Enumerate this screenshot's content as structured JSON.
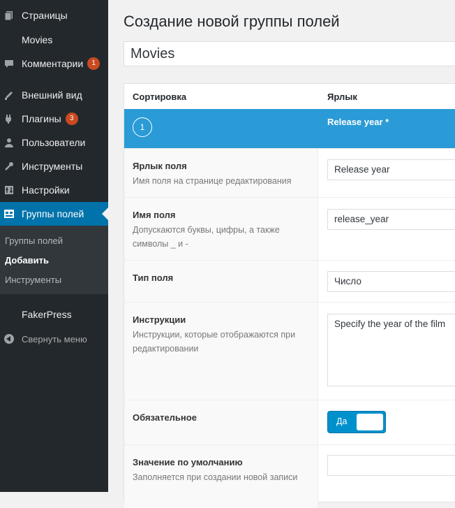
{
  "sidebar": {
    "items": [
      {
        "label": "Страницы",
        "icon": "pages-icon"
      },
      {
        "label": "Movies",
        "icon": ""
      },
      {
        "label": "Комментарии",
        "icon": "comments-icon",
        "badge": "1"
      },
      {
        "label": "Внешний вид",
        "icon": "appearance-icon"
      },
      {
        "label": "Плагины",
        "icon": "plugins-icon",
        "badge": "3"
      },
      {
        "label": "Пользователи",
        "icon": "users-icon"
      },
      {
        "label": "Инструменты",
        "icon": "tools-icon"
      },
      {
        "label": "Настройки",
        "icon": "settings-icon"
      },
      {
        "label": "Группы полей",
        "icon": "field-groups-icon",
        "current": true
      }
    ],
    "submenu": [
      "Группы полей",
      "Добавить",
      "Инструменты"
    ],
    "fakerpress": "FakerPress",
    "collapse": "Свернуть меню"
  },
  "page": {
    "title": "Создание новой группы полей",
    "group_title": "Movies"
  },
  "table": {
    "col_order": "Сортировка",
    "col_label": "Ярлык"
  },
  "field": {
    "order": "1",
    "title": "Release year *",
    "rows": {
      "label": {
        "label": "Ярлык поля",
        "desc": "Имя поля на странице редактирования",
        "value": "Release year"
      },
      "name": {
        "label": "Имя поля",
        "desc_line1": "Допускаются буквы, цифры, а также",
        "desc_line2": "символы _ и -",
        "value": "release_year"
      },
      "type": {
        "label": "Тип поля",
        "value": "Число"
      },
      "instructions": {
        "label": "Инструкции",
        "desc_line1": "Инструкции, которые отображаются при",
        "desc_line2": "редактировании",
        "value": "Specify the year of the film"
      },
      "required": {
        "label": "Обязательное",
        "toggle_label": "Да"
      },
      "default": {
        "label": "Значение по умолчанию",
        "desc": "Заполняется при создании новой записи",
        "value": ""
      }
    }
  },
  "colors": {
    "sidebar_bg": "#23282d",
    "accent": "#0073aa",
    "field_bar": "#2a9bd6",
    "badge": "#ca4a1f"
  }
}
